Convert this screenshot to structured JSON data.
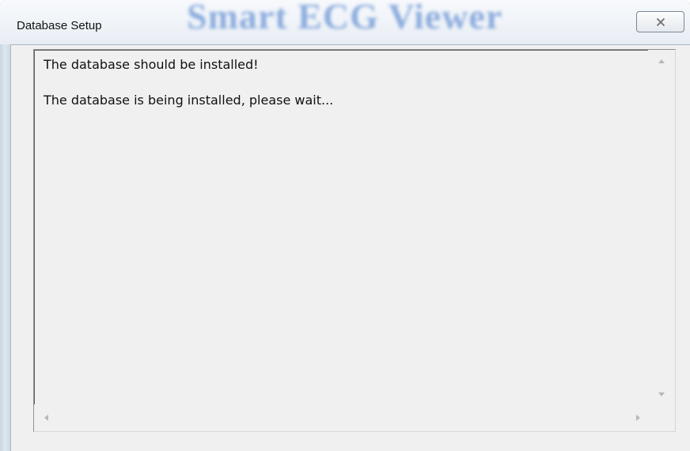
{
  "window": {
    "title": "Database Setup",
    "background_title": "Smart ECG Viewer",
    "close_icon": "close-icon"
  },
  "textbox": {
    "lines": [
      "The database should be installed!",
      "The database is being installed, please wait..."
    ]
  },
  "colors": {
    "frame": "#e3e9f0",
    "client_bg": "#f0f0f0",
    "ghost_title": "#3a72c8"
  }
}
